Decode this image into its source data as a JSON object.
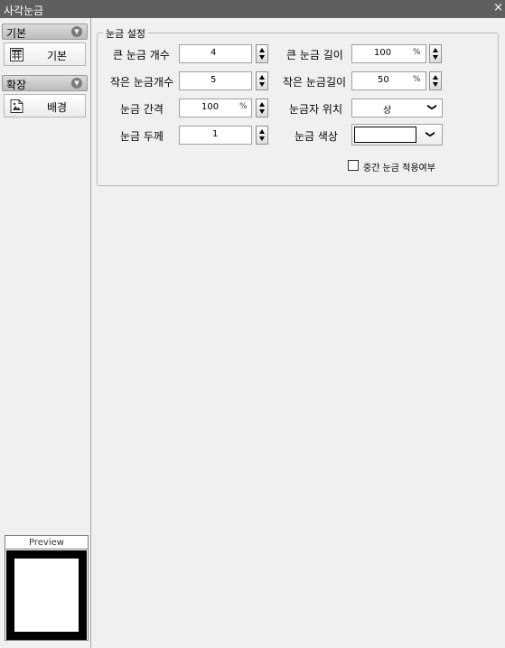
{
  "window": {
    "title": "사각눈금",
    "close_icon": "close-icon"
  },
  "sidebar": {
    "sections": [
      {
        "label": "기본",
        "items": [
          {
            "label": "기본",
            "icon": "grid-table-icon"
          }
        ]
      },
      {
        "label": "확장",
        "items": [
          {
            "label": "배경",
            "icon": "background-image-icon"
          }
        ]
      }
    ]
  },
  "preview": {
    "title": "Preview"
  },
  "settings": {
    "group_title": "눈금 설정",
    "major_count": {
      "label": "큰 눈금 개수",
      "value": "4"
    },
    "major_length": {
      "label": "큰 눈금 길이",
      "value": "100",
      "unit": "%"
    },
    "minor_count": {
      "label": "작은 눈금개수",
      "value": "5"
    },
    "minor_length": {
      "label": "작은 눈금길이",
      "value": "50",
      "unit": "%"
    },
    "interval": {
      "label": "눈금 간격",
      "value": "100",
      "unit": "%"
    },
    "ruler_position": {
      "label": "눈금자 위치",
      "value": "상",
      "options_visible": [
        "상"
      ]
    },
    "thickness": {
      "label": "눈금 두께",
      "value": "1"
    },
    "color": {
      "label": "눈금 색상",
      "value": "#ffffff"
    },
    "middle_apply": {
      "label": "중간 눈금 적용여부",
      "checked": false
    }
  }
}
